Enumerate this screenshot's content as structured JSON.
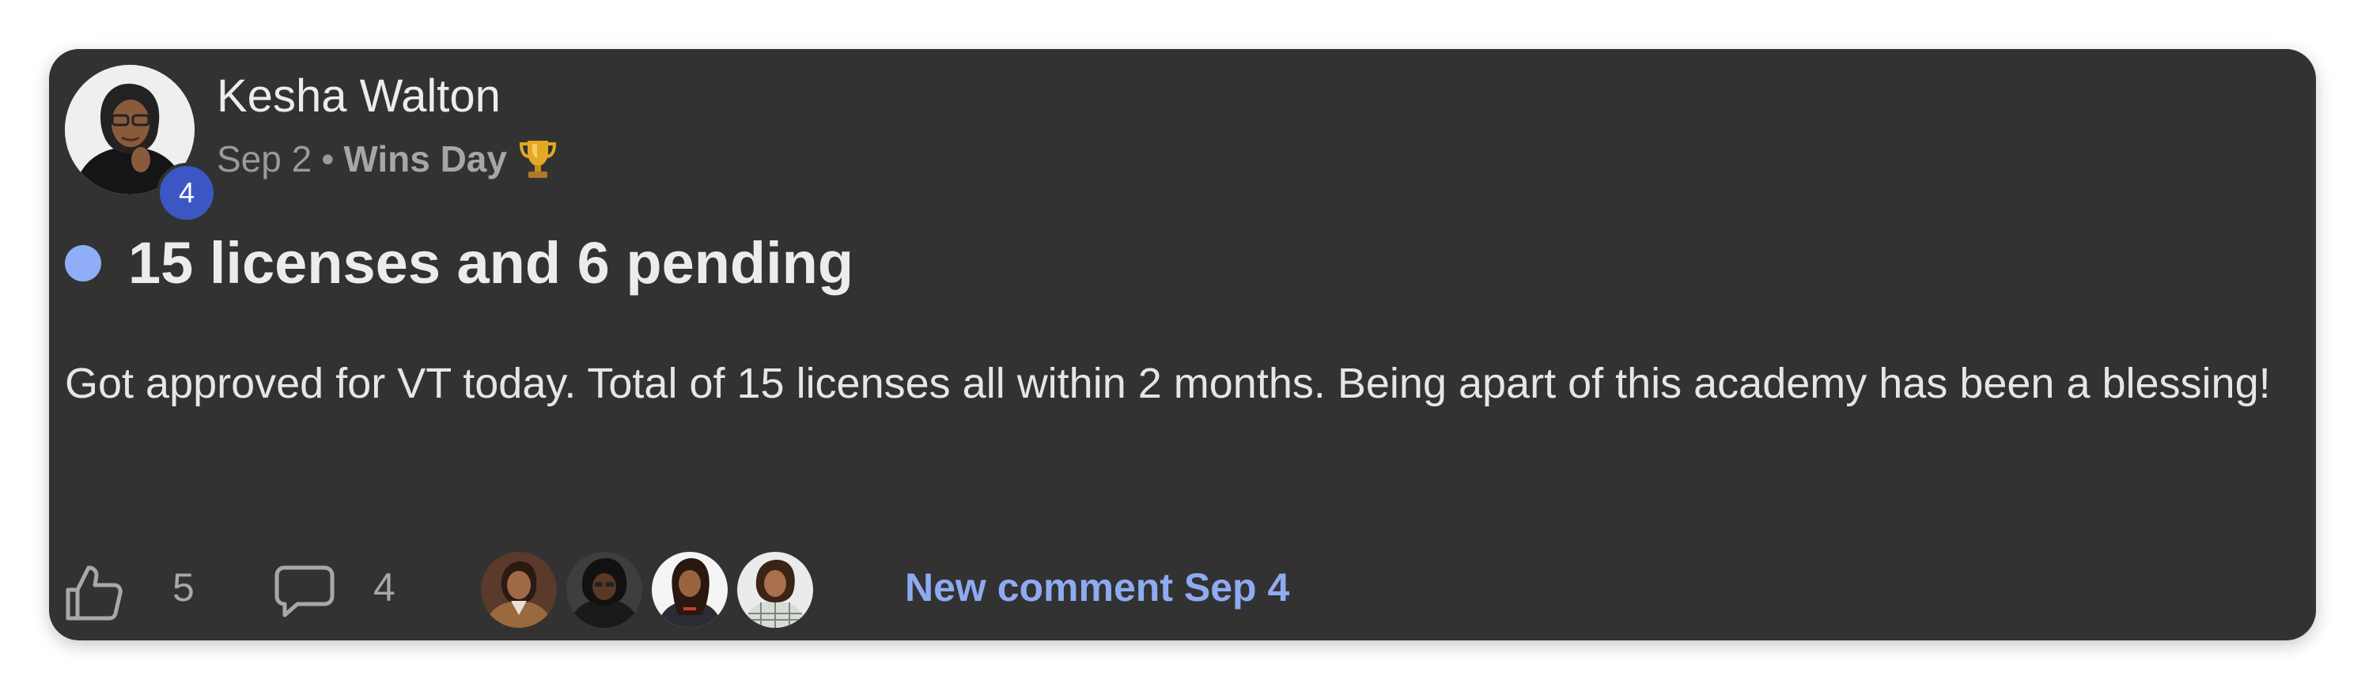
{
  "post": {
    "author": {
      "name": "Kesha Walton",
      "level": "4"
    },
    "meta": {
      "date": "Sep 2",
      "separator": "•",
      "category": "Wins Day",
      "category_icon": "trophy-icon"
    },
    "title": "15 licenses and 6 pending",
    "body": "Got approved for VT today. Total of 15 licenses all within 2 months. Being apart of this academy has been a blessing!",
    "footer": {
      "likes": "5",
      "comments": "4",
      "participant_count": 4,
      "last_comment": "New comment Sep 4"
    }
  },
  "colors": {
    "card_background": "#323232",
    "accent_blue": "#8eabf2",
    "unread_dot": "#90aef8",
    "level_badge": "#3c57c4"
  }
}
